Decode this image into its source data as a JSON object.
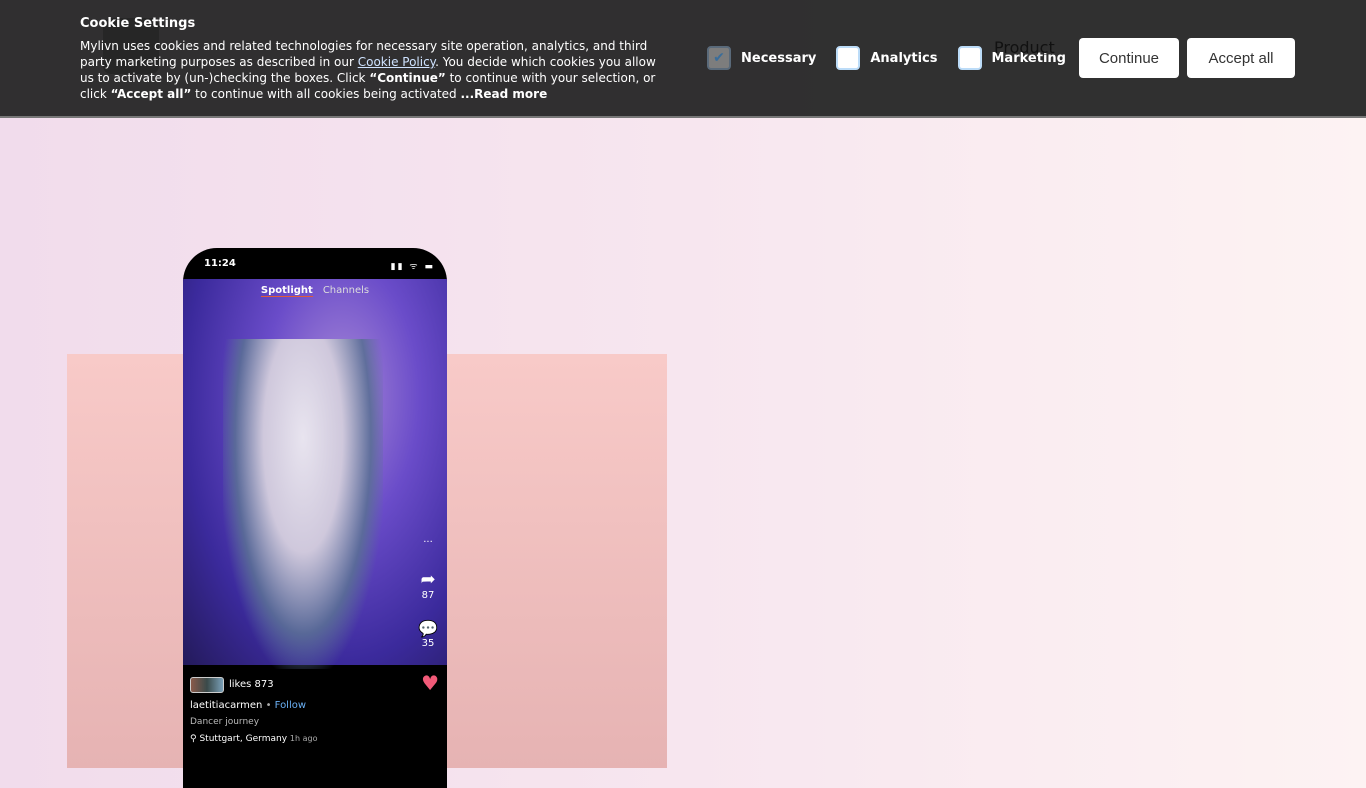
{
  "nav": {
    "product": "Product"
  },
  "cookie": {
    "title": "Cookie Settings",
    "text1": "Mylivn uses cookies and related technologies for necessary site operation, analytics, and third party marketing purposes as described in our ",
    "policy_link": "Cookie Policy",
    "text2": ". You decide which cookies you allow us to activate by (un-)checking the boxes. Click ",
    "continue_q": "“Continue”",
    "text3": " to continue with your selection, or click ",
    "accept_q": "“Accept all”",
    "text4": " to continue with all cookies being activated ",
    "read_more": "...Read more",
    "options": [
      {
        "label": "Necessary",
        "checked": true
      },
      {
        "label": "Analytics",
        "checked": false
      },
      {
        "label": "Marketing",
        "checked": false
      }
    ],
    "continue_label": "Continue",
    "accept_label": "Accept all"
  },
  "phone": {
    "time": "11:24",
    "tabs": [
      "Spotlight",
      "Channels"
    ],
    "shares": "87",
    "comments": "35",
    "likes": "likes 873",
    "user": "laetitiacarmen",
    "follow": "Follow",
    "caption": "Dancer journey",
    "location": "Stuttgart, Germany",
    "ago": "1h ago"
  }
}
